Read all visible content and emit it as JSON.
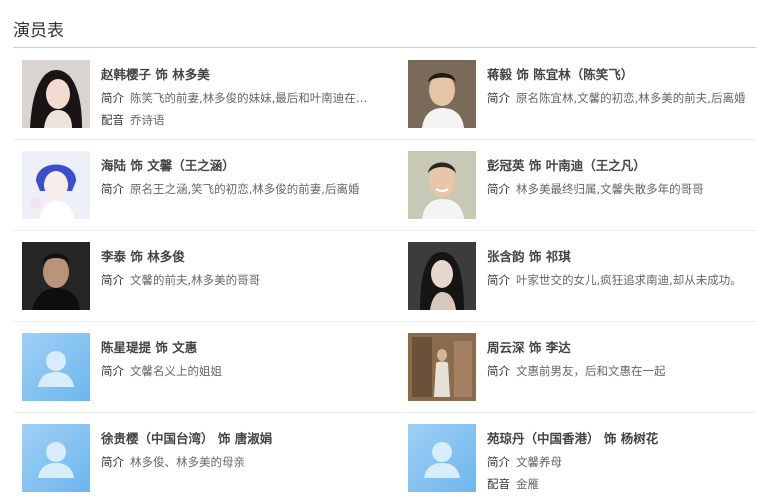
{
  "section": {
    "title": "演员表"
  },
  "cast": [
    {
      "name": "赵韩樱子 饰 林多美",
      "intro_label": "简介",
      "intro": "陈笑飞的前妻,林多俊的妹妹,最后和叶南迪在一起",
      "dub_label": "配音",
      "dub": "乔诗语",
      "photo": "photo-woman-dark-hair"
    },
    {
      "name": "蒋毅 饰 陈宜林（陈笑飞）",
      "intro_label": "简介",
      "intro": "原名陈宜林,文馨的初恋,林多美的前夫,后离婚",
      "photo": "photo-man-short-hair"
    },
    {
      "name": "海陆 饰 文馨（王之涵）",
      "intro_label": "简介",
      "intro": "原名王之涵,笑飞的初恋,林多俊的前妻,后离婚",
      "photo": "photo-woman-blue-hair"
    },
    {
      "name": "彭冠英 饰 叶南迪（王之凡）",
      "intro_label": "简介",
      "intro": "林多美最终归属,文馨失散多年的哥哥",
      "photo": "photo-man-smiling"
    },
    {
      "name": "李泰 饰 林多俊",
      "intro_label": "简介",
      "intro": "文馨的前夫,林多美的哥哥",
      "photo": "photo-man-dark"
    },
    {
      "name": "张含韵 饰 祁琪",
      "intro_label": "简介",
      "intro": "叶家世交的女儿,疯狂追求南迪,却从未成功。",
      "photo": "photo-woman-long-hair"
    },
    {
      "name": "陈星瑅提 饰 文惠",
      "intro_label": "简介",
      "intro": "文馨名义上的姐姐",
      "photo": "avatar-placeholder"
    },
    {
      "name": "周云深 饰 李达",
      "intro_label": "简介",
      "intro": "文惠前男友，后和文惠在一起",
      "photo": "photo-man-suit"
    },
    {
      "name": "徐贵樱（中国台湾） 饰 唐淑娟",
      "intro_label": "简介",
      "intro": "林多俊、林多美的母亲",
      "photo": "avatar-placeholder"
    },
    {
      "name": "苑琼丹（中国香港） 饰 杨树花",
      "intro_label": "简介",
      "intro": "文馨养母",
      "dub_label": "配音",
      "dub": "金雁",
      "photo": "avatar-placeholder"
    }
  ]
}
